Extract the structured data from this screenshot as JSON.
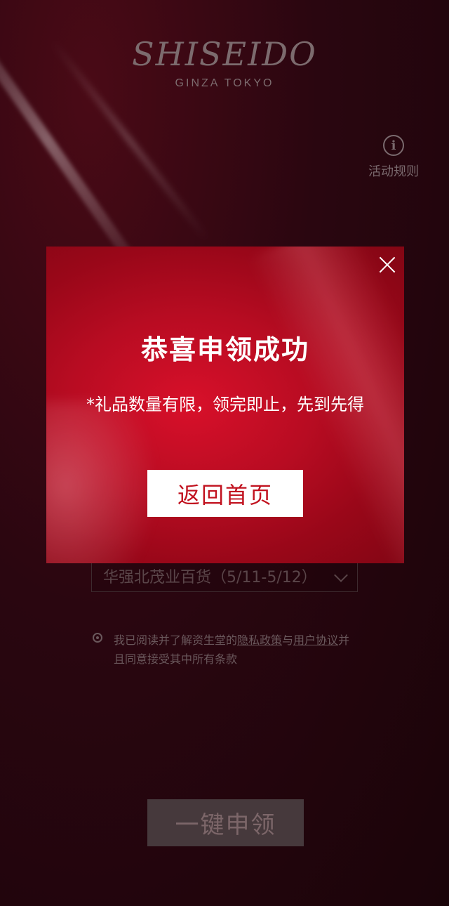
{
  "brand": {
    "logo": "SHISEIDO",
    "tagline": "GINZA TOKYO"
  },
  "header": {
    "rules_label": "活动规则"
  },
  "form": {
    "store_select_value": "华强北茂业百货（5/11-5/12）",
    "agreement_prefix": "我已阅读并了解资生堂的",
    "privacy_link": "隐私政策",
    "and_text": "与",
    "user_agreement_link": "用户协议",
    "agreement_suffix": "并且同意接受其中所有条款"
  },
  "claim_button": "一键申领",
  "modal": {
    "title": "恭喜申领成功",
    "note": "*礼品数量有限，领完即止，先到先得",
    "button": "返回首页"
  },
  "colors": {
    "modal_red": "#c1121f",
    "background_dark": "#1a0409"
  },
  "icons": {
    "info": "info-icon",
    "close": "close-icon",
    "dropdown": "chevron-down-icon",
    "radio": "radio-icon"
  }
}
